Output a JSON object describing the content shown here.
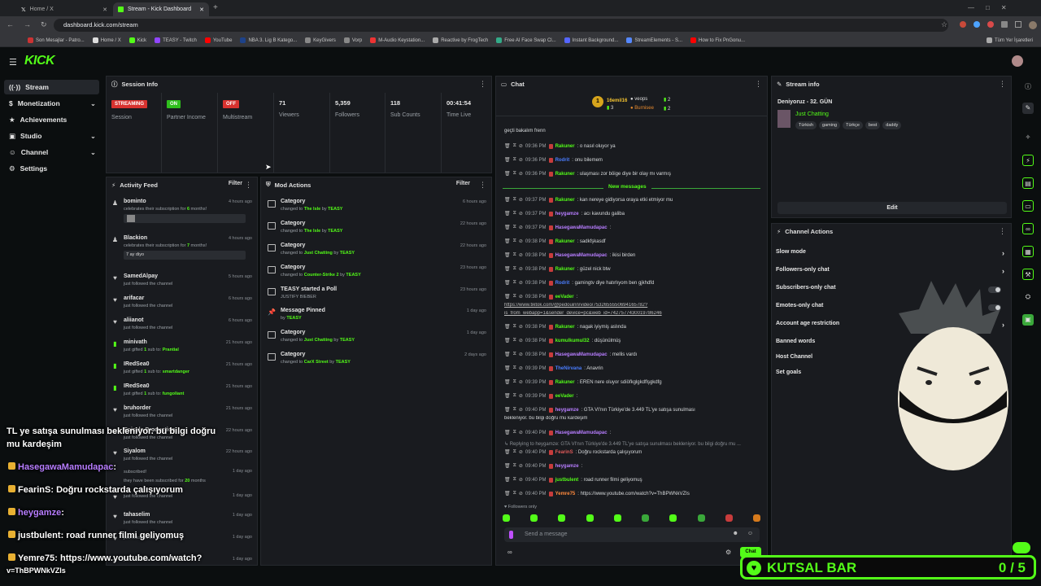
{
  "browser": {
    "tabs": [
      {
        "label": "Home / X"
      },
      {
        "label": "Stream - Kick Dashboard"
      }
    ],
    "url": "dashboard.kick.com/stream",
    "bookmarks": [
      "Son Mesajlar - Patro...",
      "Home / X",
      "Kick",
      "TEASY - Twitch",
      "YouTube",
      "NBA 3. Lig B Katego...",
      "KeyGivers",
      "Vorp",
      "M-Audio Keystation...",
      "Reactive by FrogTech",
      "Free AI Face Swap Cl...",
      "Instant Background...",
      "StreamElements - S...",
      "How to Fix PnGonu..."
    ],
    "bookmarks_all": "Tüm Yer İşaretleri"
  },
  "app": {
    "logo": "KICK"
  },
  "nav": {
    "items": [
      {
        "label": "Stream"
      },
      {
        "label": "Monetization"
      },
      {
        "label": "Achievements"
      },
      {
        "label": "Studio"
      },
      {
        "label": "Channel"
      },
      {
        "label": "Settings"
      }
    ]
  },
  "session": {
    "title": "Session Info",
    "stats": [
      {
        "value": "STREAMING",
        "label": "Session",
        "color": "#d8322f"
      },
      {
        "value": "ON",
        "label": "Partner Income",
        "color": "#2fbf1d"
      },
      {
        "value": "OFF",
        "label": "Multistream",
        "color": "#d8322f"
      },
      {
        "value": "71",
        "label": "Viewers"
      },
      {
        "value": "5,359",
        "label": "Followers"
      },
      {
        "value": "118",
        "label": "Sub Counts"
      },
      {
        "value": "00:41:54",
        "label": "Time Live"
      }
    ]
  },
  "activity": {
    "title": "Activity Feed",
    "filter": "Filter",
    "items": [
      {
        "name": "bominto",
        "pre": "celebrates their subscription for ",
        "hl": "6",
        "post": " months!",
        "time": "4 hours ago"
      },
      {
        "name": "Blackion",
        "pre": "celebrates their subscription for ",
        "hl": "7",
        "post": " months!",
        "time": "4 hours ago",
        "msg": "7 ay diyo"
      },
      {
        "name": "SamedAlpay",
        "pre": "just followed the channel",
        "time": "5 hours ago"
      },
      {
        "name": "arifacar",
        "pre": "just followed the channel",
        "time": "6 hours ago"
      },
      {
        "name": "aliianot",
        "pre": "just followed the channel",
        "time": "6 hours ago"
      },
      {
        "name": "minivath",
        "pre": "just gifted ",
        "hl": "1",
        "post": " sub to: ",
        "target": "Prantial",
        "time": "21 hours ago"
      },
      {
        "name": "IRedSea0",
        "pre": "just gifted ",
        "hl": "1",
        "post": " sub to: ",
        "target": "smartdanger",
        "time": "21 hours ago"
      },
      {
        "name": "IRedSea0",
        "pre": "just gifted ",
        "hl": "1",
        "post": " sub to: ",
        "target": "fungoliant",
        "time": "21 hours ago"
      },
      {
        "name": "bruhorder",
        "pre": "just followed the channel",
        "time": "21 hours ago"
      },
      {
        "name": "Episyle Production",
        "pre": "just followed the channel",
        "time": "22 hours ago"
      },
      {
        "name": "Siyalom",
        "pre": "just followed the channel",
        "time": "22 hours ago"
      },
      {
        "name": "",
        "pre": "subscribed!",
        "time": "1 day ago"
      },
      {
        "name": "",
        "pre": "they have been subscribed for ",
        "hl": "20",
        "post": " months",
        "time": ""
      },
      {
        "name": "",
        "pre": "just followed the channel",
        "time": "1 day ago"
      },
      {
        "name": "tahaselim",
        "pre": "just followed the channel",
        "time": "1 day ago"
      },
      {
        "name": "",
        "pre": "just followed the channel",
        "time": "1 day ago"
      },
      {
        "name": "",
        "pre": "just followed the channel",
        "time": "1 day ago"
      }
    ]
  },
  "mod": {
    "title": "Mod Actions",
    "filter": "Filter",
    "items": [
      {
        "title": "Category",
        "pre": "changed to ",
        "target": "The Isle",
        "by": "TEASY",
        "time": "6 hours ago"
      },
      {
        "title": "Category",
        "pre": "changed to ",
        "target": "The Isle",
        "by": "TEASY",
        "time": "22 hours ago"
      },
      {
        "title": "Category",
        "pre": "changed to ",
        "target": "Just Chatting",
        "by": "TEASY",
        "time": "22 hours ago"
      },
      {
        "title": "Category",
        "pre": "changed to ",
        "target": "Counter-Strike 2",
        "by": "TEASY",
        "time": "23 hours ago"
      },
      {
        "title": "TEASY started a Poll",
        "pre": "JUSTIFY BIEBER",
        "time": "23 hours ago"
      },
      {
        "title": "Message Pinned",
        "pre": "by ",
        "target": "TEASY",
        "time": "1 day ago"
      },
      {
        "title": "Category",
        "pre": "changed to ",
        "target": "Just Chatting",
        "by": "TEASY",
        "time": "1 day ago"
      },
      {
        "title": "Category",
        "pre": "changed to ",
        "target": "CarX Street",
        "by": "TEASY",
        "time": "2 days ago"
      }
    ]
  },
  "chat": {
    "title": "Chat",
    "top": [
      {
        "name": "16emil16",
        "count": "3"
      },
      {
        "name": "veops",
        "count": "2"
      },
      {
        "name": "Burnisee",
        "count": "2"
      }
    ],
    "first_line": "geçti bakalım frenn",
    "new_messages": "New messages",
    "messages": [
      {
        "time": "09:36 PM",
        "user": "Rakuner",
        "color": "#53fc18",
        "text": ": o nasıl oluyor ya"
      },
      {
        "time": "09:36 PM",
        "user": "Rodrit",
        "color": "#4a7dff",
        "text": ": onu bilemem"
      },
      {
        "time": "09:36 PM",
        "user": "Rakuner",
        "color": "#53fc18",
        "text": ": ulaşması zor böige diye bir olay mı varmış"
      },
      {
        "time": "09:37 PM",
        "user": "Rakuner",
        "color": "#53fc18",
        "text": ": kan nereye gidiyorsa oraya etki etmiyor mu"
      },
      {
        "time": "09:37 PM",
        "user": "heygamze",
        "color": "#b77dff",
        "text": ": acı kavundu galiba"
      },
      {
        "time": "09:37 PM",
        "user": "HasegawaMamudapac",
        "color": "#b77dff",
        "text": ":"
      },
      {
        "time": "09:38 PM",
        "user": "Rakuner",
        "color": "#53fc18",
        "text": ": sadkfşkasdf"
      },
      {
        "time": "09:38 PM",
        "user": "HasegawaMamudapac",
        "color": "#b77dff",
        "text": ": ikisi birden"
      },
      {
        "time": "09:38 PM",
        "user": "Rakuner",
        "color": "#53fc18",
        "text": ": güzel nick btw"
      },
      {
        "time": "09:38 PM",
        "user": "Rodrit",
        "color": "#4a7dff",
        "text": ": gamingtv diye hatırlıyom ben gjkhdfd"
      },
      {
        "time": "09:38 PM",
        "user": "eeVader",
        "color": "#53fc18",
        "text": ":"
      },
      {
        "time": "",
        "user": "",
        "color": "#bbb",
        "text": "https://www.tiktok.com/@pedouinn/video/7532655550694165782?"
      },
      {
        "time": "",
        "user": "",
        "color": "#bbb",
        "text": "is_from_webapp=1&sender_device=pc&web_id=7427577430019786246"
      },
      {
        "time": "09:38 PM",
        "user": "Rakuner",
        "color": "#53fc18",
        "text": ": nagak iyiymiş aslında"
      },
      {
        "time": "09:38 PM",
        "user": "kumulkumul32",
        "color": "#53fc18",
        "text": ": düşünülmüş"
      },
      {
        "time": "09:38 PM",
        "user": "HasegawaMamudapac",
        "color": "#b77dff",
        "text": ": mellis vardı"
      },
      {
        "time": "09:39 PM",
        "user": "TheNirvana",
        "color": "#4a7dff",
        "text": ": Anavrin"
      },
      {
        "time": "09:39 PM",
        "user": "Rakuner",
        "color": "#53fc18",
        "text": ": EREN nere oluyor sdiöfkglgkdflşgkdfg"
      },
      {
        "time": "09:39 PM",
        "user": "eeVader",
        "color": "#53fc18",
        "text": ":"
      },
      {
        "time": "09:40 PM",
        "user": "heygamze",
        "color": "#b77dff",
        "text": ": GTA VI'nın Türkiye'de 3.449 TL'ye satışa sunulması"
      },
      {
        "time": "",
        "user": "",
        "color": "#d7dadc",
        "text": "bekleniyor. bu bilgi doğru mu kardeşim"
      },
      {
        "time": "09:40 PM",
        "user": "HasegawaMamudapac",
        "color": "#b77dff",
        "text": ":"
      },
      {
        "time": "",
        "user": "",
        "color": "#8a8f95",
        "text": "↳ Replying to heygamze: GTA VI'nın Türkiye'de 3.449 TL'ye satışa sunulması bekleniyor. bu bilgi doğru mu ..."
      },
      {
        "time": "09:40 PM",
        "user": "FearinS",
        "color": "#e05a5a",
        "text": ": Doğru rockstarda çalışıyorum"
      },
      {
        "time": "09:40 PM",
        "user": "heygamze",
        "color": "#b77dff",
        "text": ":"
      },
      {
        "time": "09:40 PM",
        "user": "justbulent",
        "color": "#53fc18",
        "text": ": road runner filmi geliyomuş"
      },
      {
        "time": "09:40 PM",
        "user": "Yemre75",
        "color": "#ff8a3d",
        "text": ": https://www.youtube.com/watch?v=ThBPWNkVZIs"
      }
    ],
    "followers_only": "Followers only",
    "placeholder": "Send a message",
    "send": "Chat"
  },
  "stream_info": {
    "title": "Stream info",
    "stream_title": "Deniyoruz - 32. GÜN",
    "category": "Just Chatting",
    "tags": [
      "Türkish",
      "gaming",
      "Türkçe",
      "best",
      "daddy"
    ],
    "edit": "Edit"
  },
  "channel_actions": {
    "title": "Channel Actions",
    "items": [
      {
        "label": "Slow mode",
        "kind": "arrow"
      },
      {
        "label": "Followers-only chat",
        "kind": "arrow"
      },
      {
        "label": "Subscribers-only chat",
        "kind": "toggle"
      },
      {
        "label": "Emotes-only chat",
        "kind": "toggle"
      },
      {
        "label": "Account age restriction",
        "kind": "arrow"
      },
      {
        "label": "Banned words",
        "kind": "none"
      },
      {
        "label": "Host Channel",
        "kind": "none"
      },
      {
        "label": "Set goals",
        "kind": "none"
      }
    ]
  },
  "overlay": {
    "lines": [
      {
        "user": "",
        "color": "#ffffff",
        "text": "TL ye satışa sunulması bekleniyor. bu bilgi doğru"
      },
      {
        "user": "",
        "color": "#ffffff",
        "text": "mu kardeşim"
      },
      {
        "user": "HasegawaMamudapac",
        "color": "#b77dff",
        "text": ":"
      },
      {
        "user": "FearinS",
        "color": "#ffffff",
        "text": ": Doğru rockstarda çalışıyorum"
      },
      {
        "user": "heygamze",
        "color": "#b77dff",
        "text": ":"
      },
      {
        "user": "justbulent",
        "color": "#ffffff",
        "text": ": road runner filmi geliyomuş"
      },
      {
        "user": "Yemre75",
        "color": "#ffffff",
        "text": ": https://www.youtube.com/watch?"
      },
      {
        "user": "",
        "color": "#ffffff",
        "text": "v=ThBPWNkVZIs"
      }
    ],
    "goal_label": "KUTSAL BAR",
    "goal_progress": "0 / 5",
    "accent": "#53fc18"
  }
}
